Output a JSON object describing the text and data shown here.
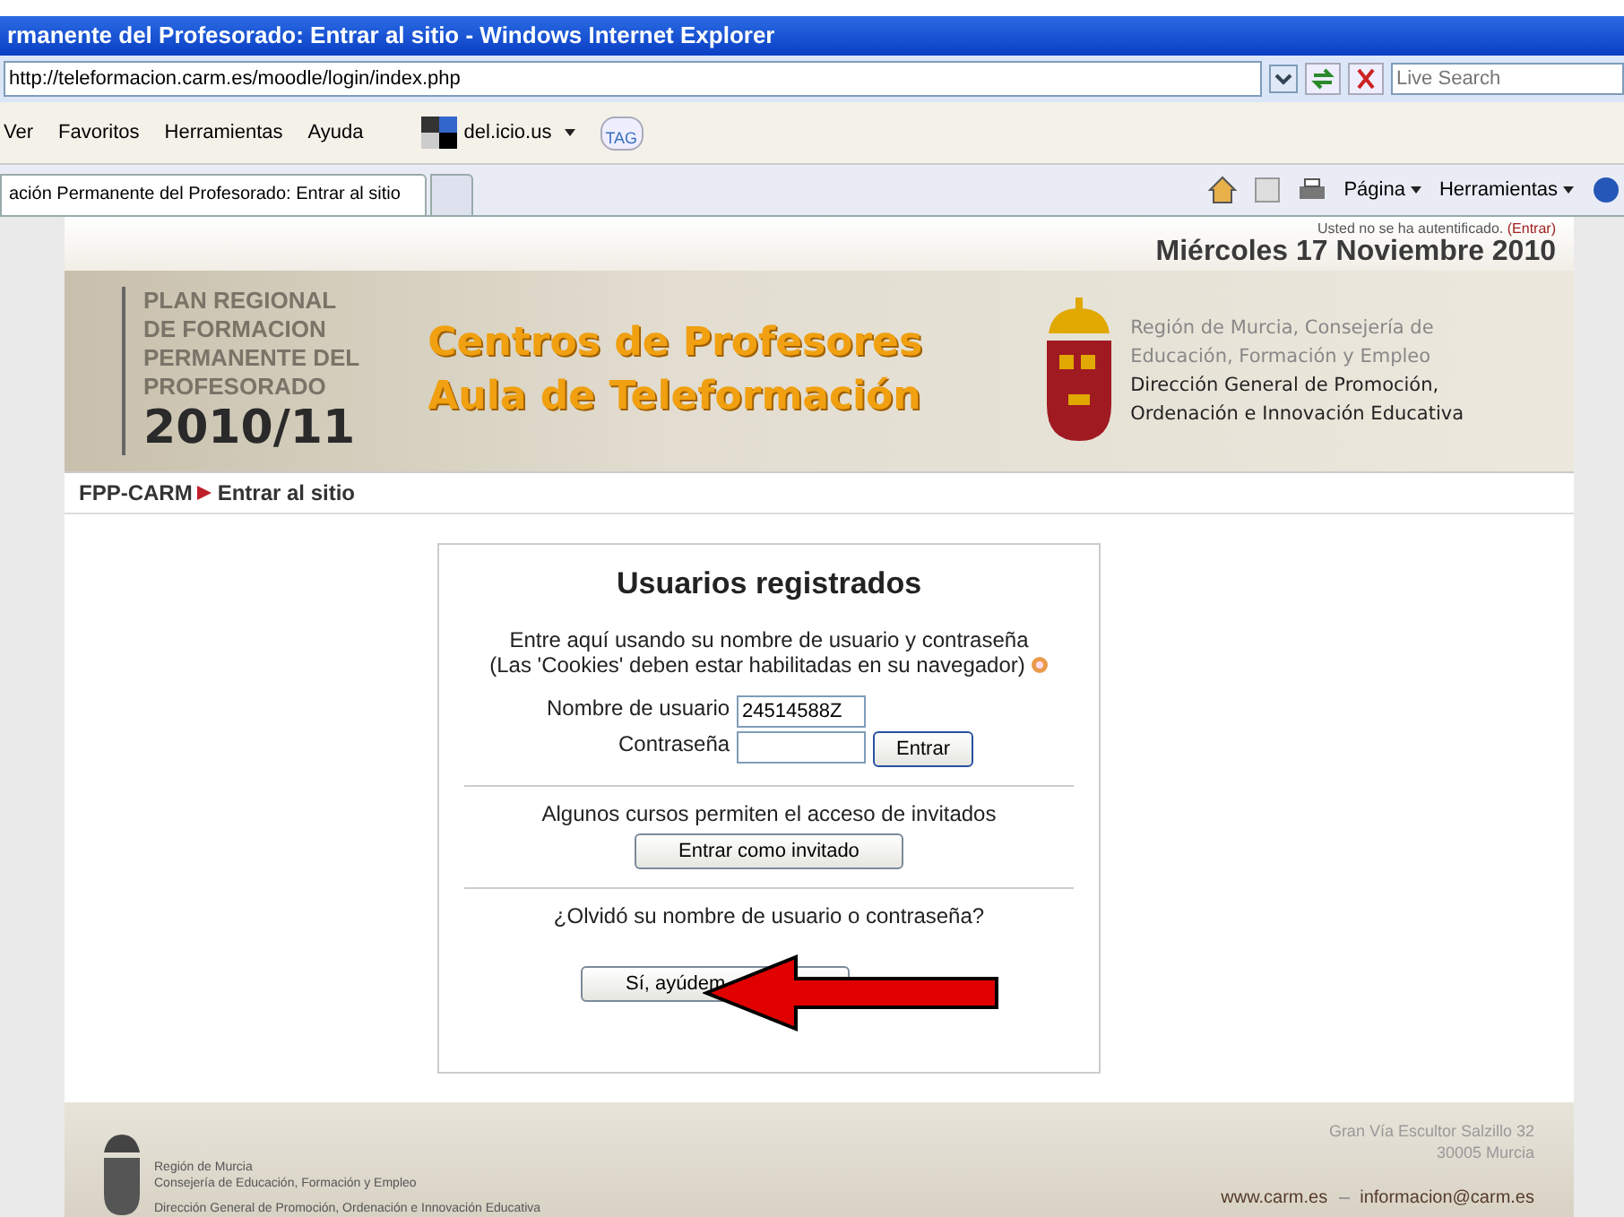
{
  "window": {
    "title": "rmanente del Profesorado: Entrar al sitio - Windows Internet Explorer"
  },
  "address_bar": {
    "url": "http://teleformacion.carm.es/moodle/login/index.php",
    "search_placeholder": "Live Search"
  },
  "menu": [
    "Ver",
    "Favoritos",
    "Herramientas",
    "Ayuda"
  ],
  "toolbar": {
    "bookmark": "del.icio.us",
    "tag": "TAG"
  },
  "tabs": [
    {
      "label": "ación Permanente del Profesorado: Entrar al sitio",
      "selected": true
    }
  ],
  "command_bar": [
    "Página",
    "Herramientas"
  ],
  "header": {
    "login_notice": "Usted no se ha autentificado.",
    "login_link": "(Entrar)",
    "date": "Miércoles 17 Noviembre 2010",
    "plan_lines": [
      "PLAN REGIONAL",
      "DE FORMACION",
      "PERMANENTE DEL",
      "PROFESORADO"
    ],
    "year": "2010/11",
    "title_lines": [
      "Centros de Profesores",
      "Aula de Teleformación"
    ],
    "org_lines": [
      "Región de Murcia, Consejería de",
      "Educación, Formación y Empleo"
    ],
    "dept_lines": [
      "Dirección General de Promoción,",
      "Ordenación e Innovación Educativa"
    ]
  },
  "breadcrumb": {
    "home": "FPP-CARM",
    "current": "Entrar al sitio"
  },
  "login": {
    "title": "Usuarios registrados",
    "intro": [
      "Entre aquí usando su nombre de usuario y contraseña",
      "(Las 'Cookies' deben estar habilitadas en su navegador)"
    ],
    "username_label": "Nombre de usuario",
    "username": "24514588Z",
    "password_label": "Contraseña",
    "submit": "Entrar",
    "guest_text": "Algunos cursos permiten el acceso de invitados",
    "guest_button": "Entrar como invitado",
    "forgot_text": "¿Olvidó su nombre de usuario o contraseña?",
    "forgot_button": "Sí, ayúdem"
  },
  "footer": {
    "org_lines": [
      "Región de Murcia",
      "Consejería de Educación, Formación y Empleo"
    ],
    "dept": "Dirección General de Promoción, Ordenación e Innovación Educativa",
    "address": [
      "Gran Vía Escultor Salzillo 32",
      "30005 Murcia"
    ],
    "links": [
      "www.carm.es",
      "informacion@carm.es"
    ]
  }
}
